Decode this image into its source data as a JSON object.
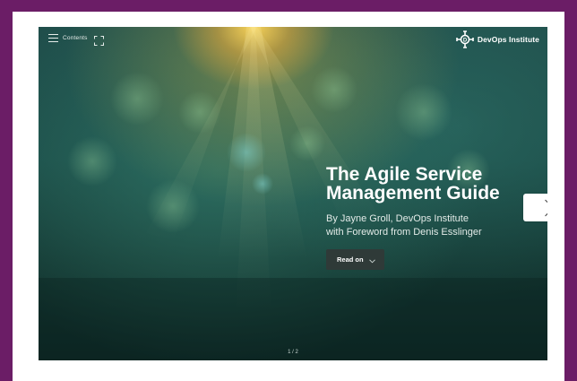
{
  "toolbar": {
    "contents_label": "Contents",
    "menu_icon": "hamburger-icon",
    "fullscreen_icon": "fullscreen-icon"
  },
  "brand": {
    "name": "DevOps Institute",
    "logo_icon": "devops-institute-logo"
  },
  "cover": {
    "title_line1": "The Agile Service",
    "title_line2": "Management Guide",
    "byline_line1": "By Jayne Groll, DevOps Institute",
    "byline_line2": "with Foreword from Denis Esslinger",
    "read_on_label": "Read on",
    "read_on_icon": "chevron-down-icon"
  },
  "navigation": {
    "next_icon": "chevron-right-icon",
    "page_indicator": "1 / 2"
  },
  "colors": {
    "background": "#6b1d66",
    "frame": "#ffffff",
    "button_dark": "#2f3a38",
    "cover_base": "#1a4a46"
  }
}
